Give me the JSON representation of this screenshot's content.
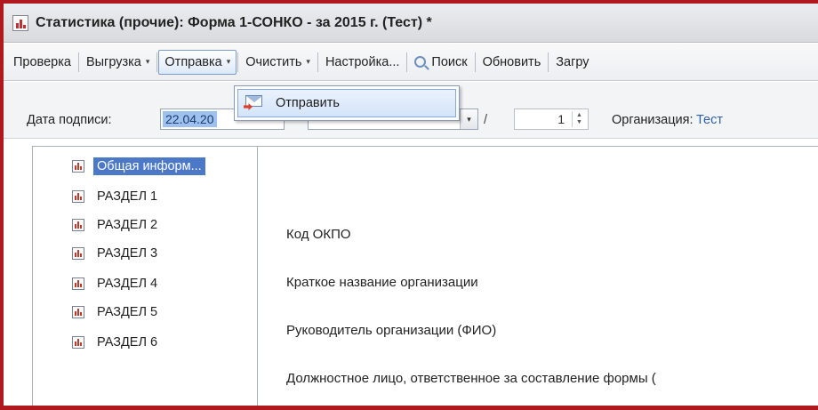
{
  "window": {
    "title": "Статистика (прочие): Форма 1-СОНКО - за 2015 г. (Тест) *"
  },
  "toolbar": {
    "items": [
      {
        "label": "Проверка",
        "has_menu": false
      },
      {
        "label": "Выгрузка",
        "has_menu": true
      },
      {
        "label": "Отправка",
        "has_menu": true
      },
      {
        "label": "Очистить",
        "has_menu": true
      },
      {
        "label": "Настройка...",
        "has_menu": false
      },
      {
        "label": "Поиск",
        "icon": "search-icon"
      },
      {
        "label": "Обновить",
        "has_menu": false
      },
      {
        "label": "Загру",
        "has_menu": false
      }
    ],
    "caret": "▾",
    "active_item": "Отправка"
  },
  "params": {
    "sign_date_label": "Дата подписи:",
    "sign_date_value": "22.04.20",
    "slash": "/",
    "page_number": "1",
    "org_label": "Организация:",
    "org_value": "Тест"
  },
  "dropdown_menu": {
    "items": [
      {
        "label": "Отправить",
        "icon": "send-email-icon"
      }
    ]
  },
  "tree": {
    "items": [
      {
        "label": "Общая информ...",
        "selected": true
      },
      {
        "label": "РАЗДЕЛ 1",
        "selected": false
      },
      {
        "label": "РАЗДЕЛ 2",
        "selected": false
      },
      {
        "label": "РАЗДЕЛ 3",
        "selected": false
      },
      {
        "label": "РАЗДЕЛ 4",
        "selected": false
      },
      {
        "label": "РАЗДЕЛ 5",
        "selected": false
      },
      {
        "label": "РАЗДЕЛ 6",
        "selected": false
      }
    ]
  },
  "form": {
    "fields": [
      {
        "label": "Код ОКПО"
      },
      {
        "label": "Краткое название организации"
      },
      {
        "label": "Руководитель организации (ФИО)"
      },
      {
        "label": "Должностное лицо, ответственное за составление формы ("
      }
    ]
  },
  "colors": {
    "frame_border": "#b0191d",
    "selection": "#4b79c7",
    "link": "#2f5fa8"
  }
}
